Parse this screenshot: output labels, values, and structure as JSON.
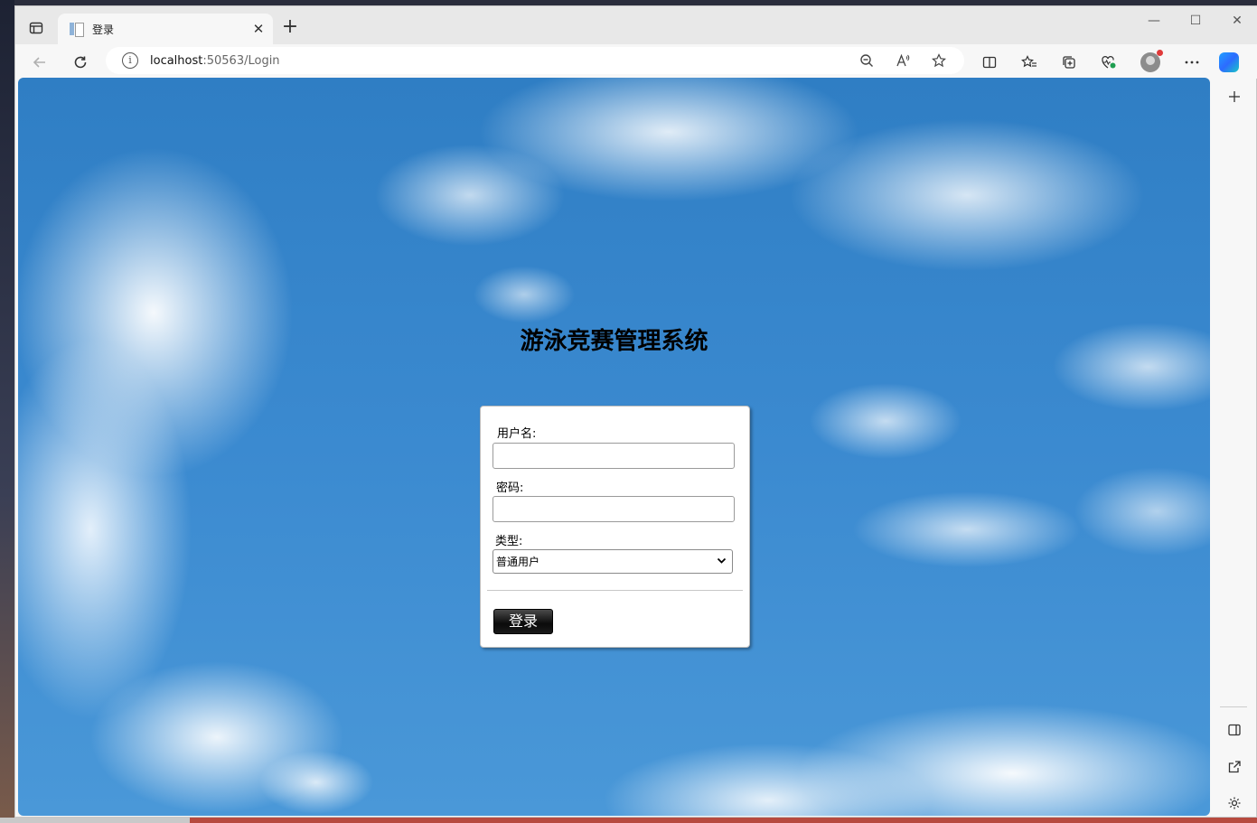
{
  "browser": {
    "tab_title": "登录",
    "tab_close": "✕",
    "new_tab": "+",
    "url_host": "localhost",
    "url_path": ":50563/Login",
    "window_controls": {
      "minimize": "—",
      "maximize": "☐",
      "close": "✕"
    }
  },
  "page": {
    "title": "游泳竞赛管理系统",
    "username_label": "用户名:",
    "password_label": "密码:",
    "type_label": "类型:",
    "type_selected": "普通用户",
    "login_button": "登录"
  },
  "colors": {
    "sky": "#3b8ad0",
    "button": "#111111"
  }
}
